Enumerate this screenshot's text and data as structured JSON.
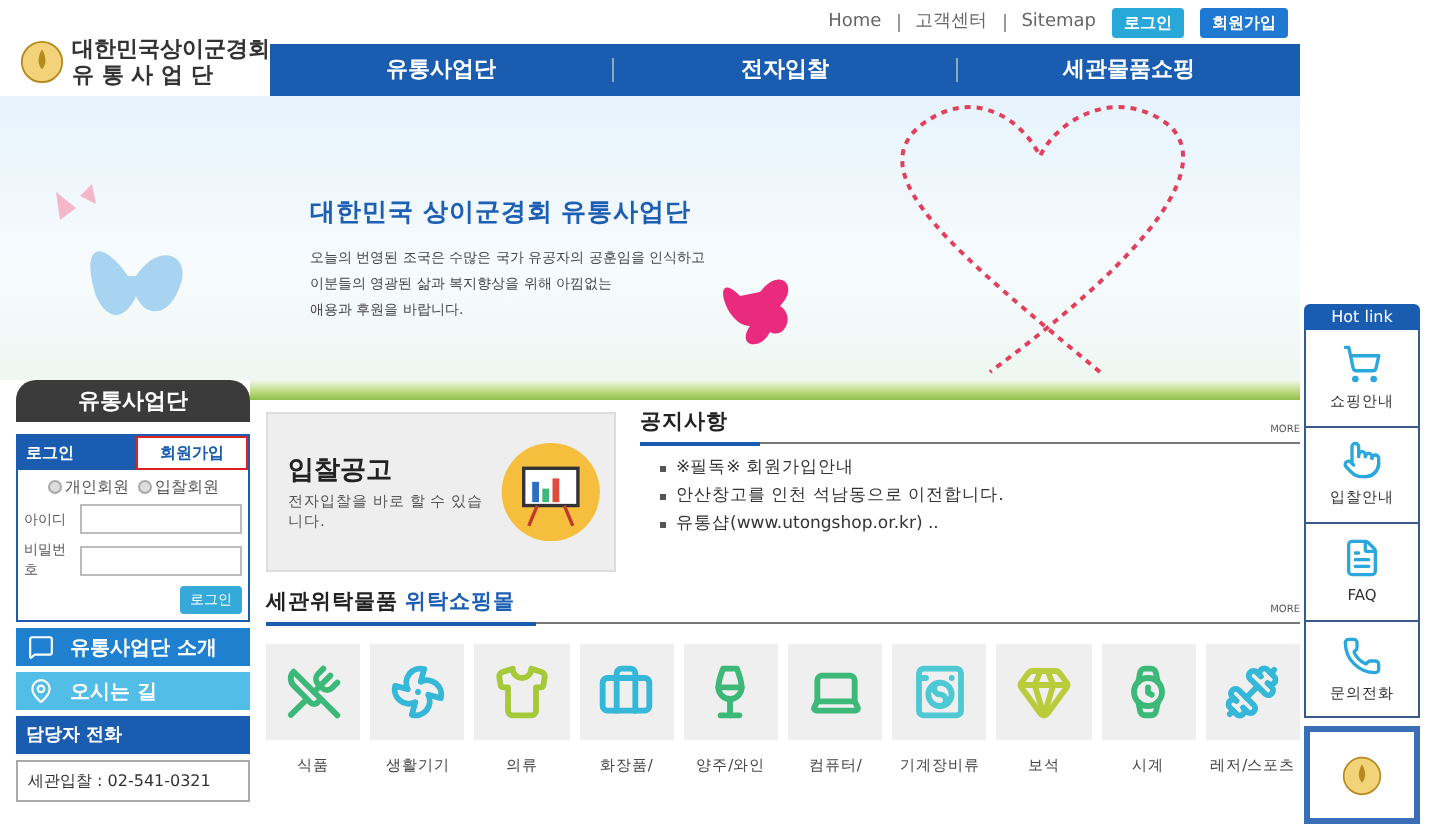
{
  "header": {
    "logo_lines": [
      "대한민국상이군경회",
      "유 통 사 업 단"
    ],
    "top_links": [
      "Home",
      "고객센터",
      "Sitemap"
    ],
    "login_button": "로그인",
    "join_button": "회원가입"
  },
  "nav": [
    "유통사업단",
    "전자입찰",
    "세관물품쇼핑"
  ],
  "hero": {
    "title": "대한민국 상이군경회 유통사업단",
    "lines": [
      "오늘의 번영된 조국은 수많은 국가 유공자의 공훈임을 인식하고",
      "이분들의 영광된 삶과 복지향상을 위해 아낌없는",
      "애용과 후원을 바랍니다."
    ]
  },
  "sidebar": {
    "tab": "유통사업단",
    "login": {
      "tabs": [
        {
          "label": "로그인",
          "selected": true
        },
        {
          "label": "회원가입",
          "selected": false
        }
      ],
      "radios": [
        {
          "label": "개인회원",
          "selected": false
        },
        {
          "label": "입찰회원",
          "selected": false
        }
      ],
      "fields": [
        {
          "label": "아이디"
        },
        {
          "label": "비밀번호"
        }
      ],
      "submit": "로그인"
    },
    "menu": [
      "유통사업단 소개",
      "오시는 길"
    ],
    "phone": {
      "title": "담당자 전화",
      "lines": [
        "세관입찰 : 02-541-0321"
      ]
    }
  },
  "bid": {
    "title": "입찰공고",
    "text": "전자입찰을 바로 할 수 있습니다."
  },
  "notices": {
    "title": "공지사항",
    "more": "MORE",
    "items": [
      "※필독※ 회원가입안내",
      "안산창고를 인천 석남동으로 이전합니다.",
      "유통샵(www.utongshop.or.kr) .."
    ]
  },
  "shop": {
    "title": "세관위탁물품",
    "highlight": "위탁쇼핑몰",
    "more": "MORE",
    "categories": [
      "식품",
      "생활기기",
      "의류",
      "화장품/",
      "양주/와인",
      "컴퓨터/",
      "기계장비류",
      "보석",
      "시계",
      "레저/스포츠"
    ]
  },
  "hotlink": {
    "title": "Hot link",
    "items": [
      "쇼핑안내",
      "입찰안내",
      "FAQ",
      "문의전화"
    ]
  }
}
